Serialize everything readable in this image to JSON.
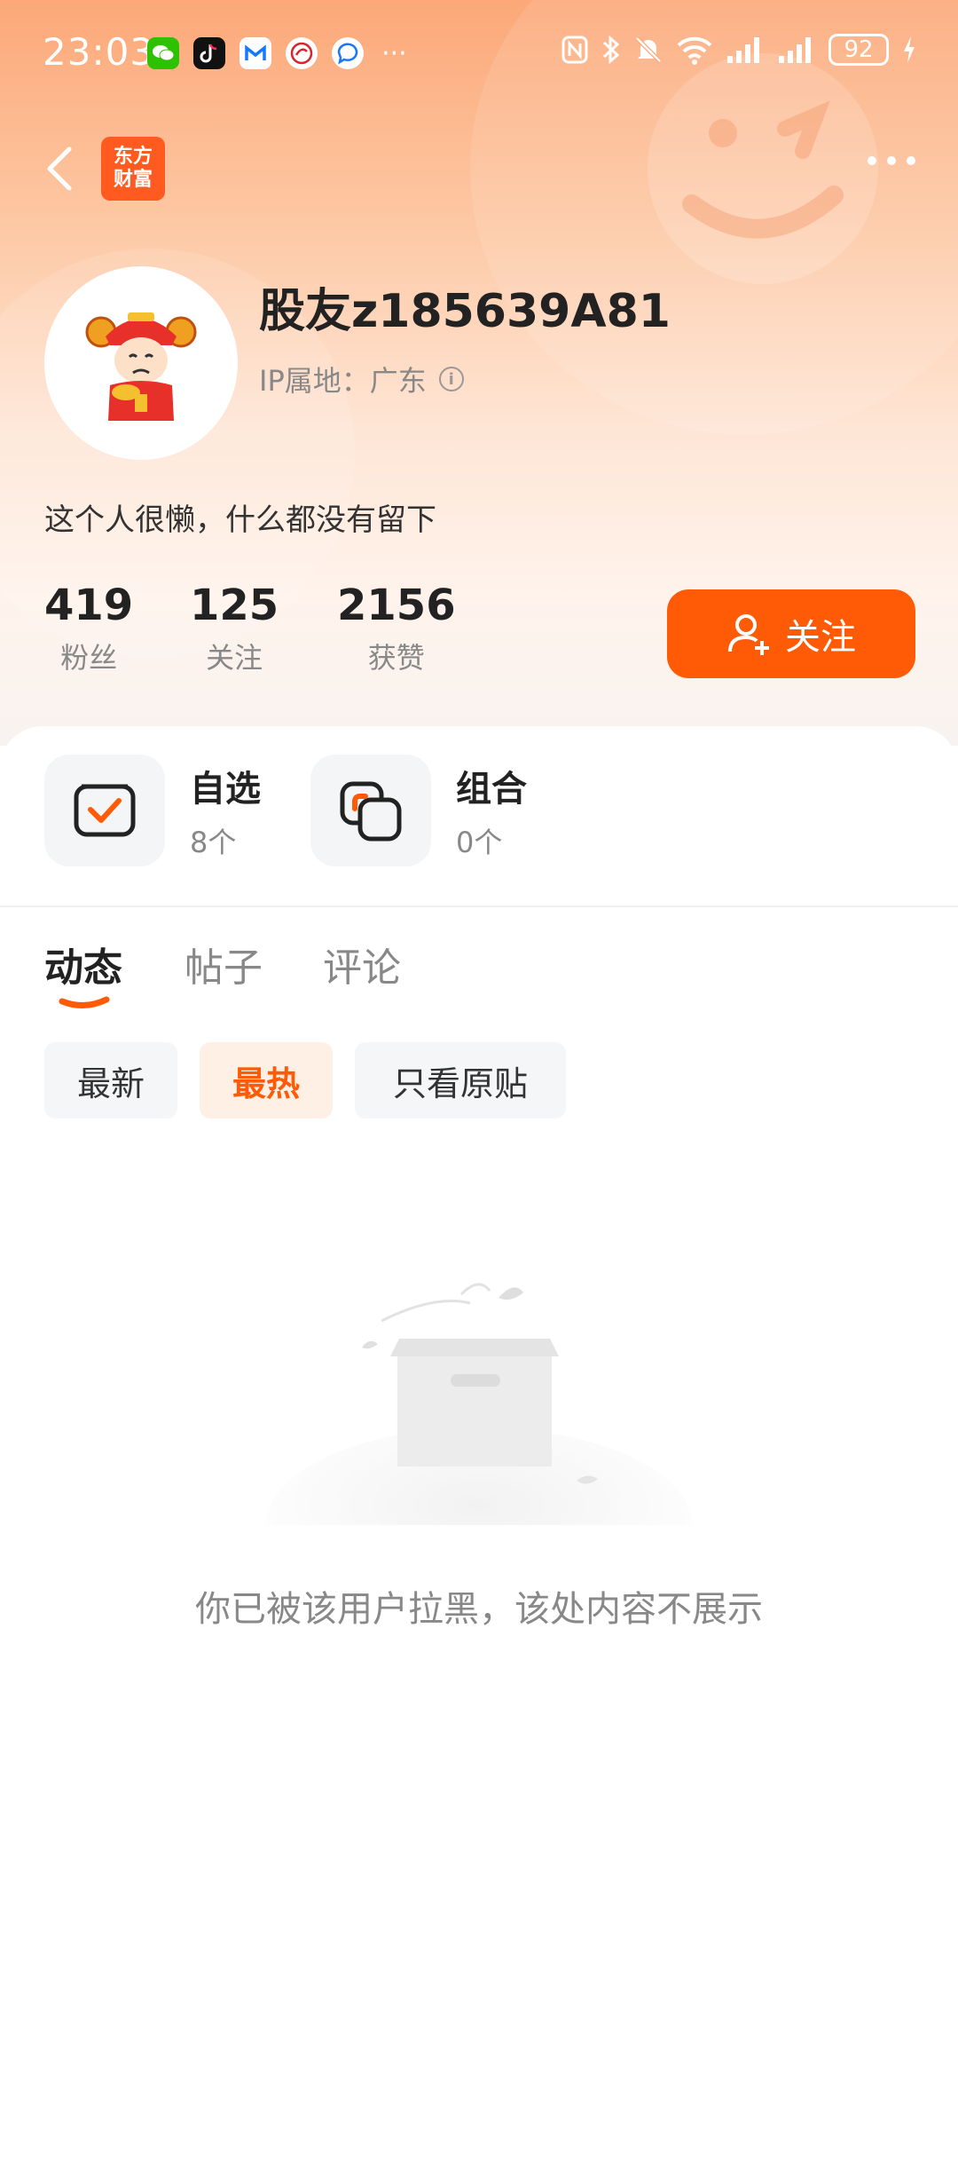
{
  "status_bar": {
    "time": "23:03",
    "app_icons": [
      "wechat-icon",
      "douyin-icon",
      "mail-icon",
      "app-red-icon",
      "chat-icon"
    ],
    "battery": "92"
  },
  "nav": {
    "logo_line1": "东方",
    "logo_line2": "财富"
  },
  "profile": {
    "username": "股友z185639A81",
    "ip_location": "IP属地：广东",
    "bio": "这个人很懒，什么都没有留下",
    "stats": [
      {
        "value": "419",
        "label": "粉丝"
      },
      {
        "value": "125",
        "label": "关注"
      },
      {
        "value": "2156",
        "label": "获赞"
      }
    ],
    "follow_label": "关注"
  },
  "features": [
    {
      "title": "自选",
      "sub": "8个"
    },
    {
      "title": "组合",
      "sub": "0个"
    }
  ],
  "tabs": [
    {
      "label": "动态",
      "active": true
    },
    {
      "label": "帖子",
      "active": false
    },
    {
      "label": "评论",
      "active": false
    }
  ],
  "filters": [
    {
      "label": "最新",
      "active": false
    },
    {
      "label": "最热",
      "active": true
    },
    {
      "label": "只看原贴",
      "active": false
    }
  ],
  "empty_message": "你已被该用户拉黑，该处内容不展示",
  "colors": {
    "accent": "#ff5a05",
    "hero_top": "#fca878",
    "text_primary": "#222222",
    "text_secondary": "#888888"
  }
}
